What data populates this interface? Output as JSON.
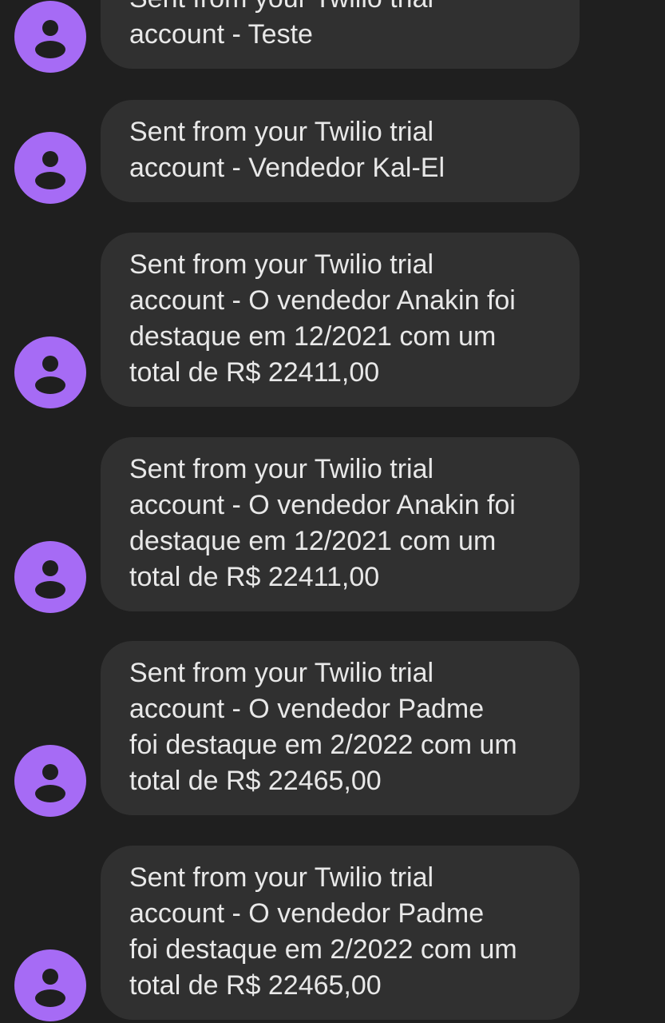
{
  "theme": {
    "background": "#1f1f1f",
    "bubble": "#303030",
    "text": "#e8e8e8",
    "avatar": "#a66bf5",
    "avatar_icon": "#1f1f1f"
  },
  "messages": [
    {
      "text": "Sent from your Twilio trial\naccount - Teste",
      "avatar_icon": "person-icon"
    },
    {
      "text": "Sent from your Twilio trial\naccount - Vendedor Kal-El",
      "avatar_icon": "person-icon"
    },
    {
      "text": "Sent from your Twilio trial\naccount - O vendedor Anakin foi\ndestaque em 12/2021 com um\ntotal de R$ 22411,00",
      "avatar_icon": "person-icon"
    },
    {
      "text": "Sent from your Twilio trial\naccount - O vendedor Anakin foi\ndestaque em 12/2021 com um\ntotal de R$ 22411,00",
      "avatar_icon": "person-icon"
    },
    {
      "text": "Sent from your Twilio trial\naccount - O vendedor Padme\nfoi destaque em 2/2022 com um\ntotal de R$ 22465,00",
      "avatar_icon": "person-icon"
    },
    {
      "text": "Sent from your Twilio trial\naccount - O vendedor Padme\nfoi destaque em 2/2022 com um\ntotal de R$ 22465,00",
      "avatar_icon": "person-icon"
    }
  ]
}
